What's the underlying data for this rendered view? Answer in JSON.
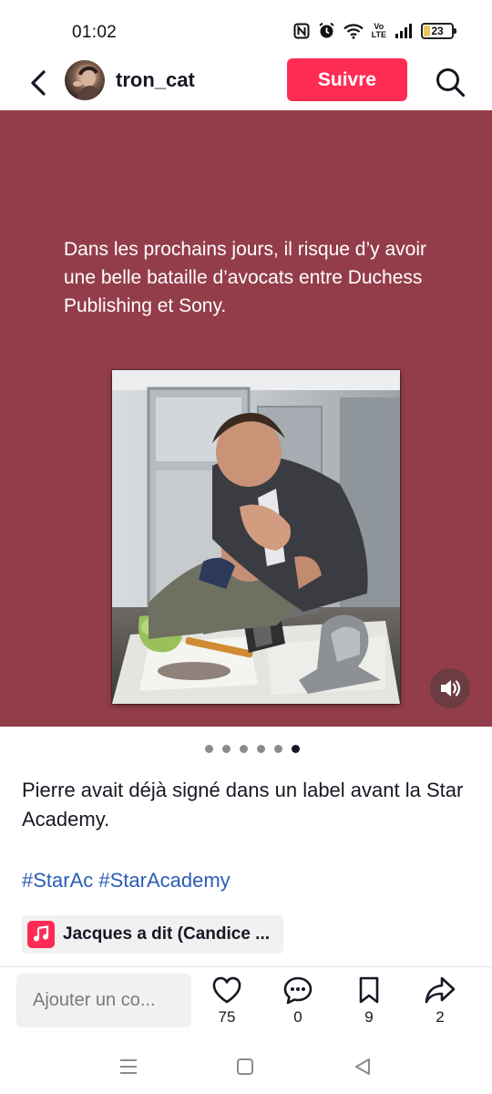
{
  "status_bar": {
    "time": "01:02",
    "battery": "23",
    "volte_top": "Vo",
    "volte_bottom": "LTE",
    "icons": [
      "nfc-icon",
      "alarm-icon",
      "wifi-icon",
      "volte-icon",
      "signal-icon",
      "battery-icon"
    ]
  },
  "header": {
    "username": "tron_cat",
    "follow_label": "Suivre",
    "back_icon": "chevron-left-icon",
    "search_icon": "search-icon"
  },
  "post": {
    "overlay_text": "Dans les prochains jours, il risque d’y avoir une belle bataille d’avocats entre Duchess Publishing et Sony.",
    "background_color": "#943d4a",
    "sound_icon": "speaker-icon",
    "carousel": {
      "total": 6,
      "active_index": 5
    }
  },
  "description": {
    "text": "Pierre avait déjà signé dans un label avant la Star Academy.",
    "hashtags": [
      "#StarAc",
      "#StarAcademy"
    ]
  },
  "music": {
    "title": "Jacques a dit (Candice ...",
    "icon": "music-note-icon"
  },
  "actions": {
    "comment_placeholder": "Ajouter un co...",
    "like_count": "75",
    "comment_count": "0",
    "save_count": "9",
    "share_count": "2"
  },
  "colors": {
    "accent": "#fe2c55",
    "hashtag": "#2b5db3",
    "text": "#161823"
  }
}
